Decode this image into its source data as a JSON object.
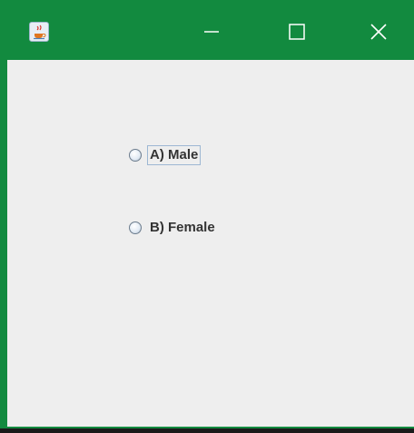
{
  "window": {
    "accent_color": "#128a3f",
    "app_icon": "java-coffee-cup-icon",
    "controls": {
      "minimize_icon": "minimize-icon",
      "maximize_icon": "maximize-icon",
      "close_icon": "close-icon"
    }
  },
  "form": {
    "options": [
      {
        "label": "A) Male",
        "selected": false,
        "focused": true
      },
      {
        "label": "B) Female",
        "selected": false,
        "focused": false
      }
    ]
  }
}
